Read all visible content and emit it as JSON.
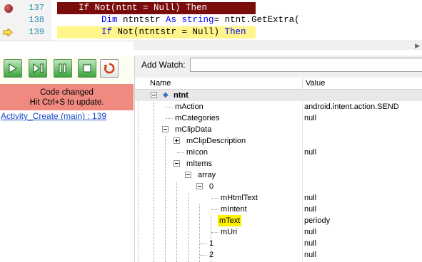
{
  "code": {
    "lines": [
      {
        "num": "137",
        "text": "If Not(ntnt = Null) Then"
      },
      {
        "num": "138",
        "kw": "Dim",
        "mid": " ntntstr ",
        "kw2": "As",
        "type": " string",
        "rest": "= ntnt.GetExtra("
      },
      {
        "num": "139",
        "text": "If Not(ntntstr = Null) Then"
      }
    ]
  },
  "toolbar": {
    "buttons": [
      "continue",
      "step-over",
      "pause",
      "stop",
      "restart"
    ]
  },
  "status": {
    "line1": "Code changed",
    "line2": "Hit Ctrl+S to update."
  },
  "stack": {
    "link": "Activity_Create (main) : 139"
  },
  "watch": {
    "add_label": "Add Watch:",
    "add_value": "",
    "col_name": "Name",
    "col_value": "Value",
    "rows": [
      {
        "name": "ntnt",
        "value": ""
      },
      {
        "name": "mAction",
        "value": "android.intent.action.SEND"
      },
      {
        "name": "mCategories",
        "value": "null"
      },
      {
        "name": "mClipData",
        "value": ""
      },
      {
        "name": "mClipDescription",
        "value": ""
      },
      {
        "name": "mIcon",
        "value": "null"
      },
      {
        "name": "mItems",
        "value": ""
      },
      {
        "name": "array",
        "value": ""
      },
      {
        "name": "0",
        "value": ""
      },
      {
        "name": "mHtmlText",
        "value": "null"
      },
      {
        "name": "mIntent",
        "value": "null"
      },
      {
        "name": "mText",
        "value": "periody"
      },
      {
        "name": "mUri",
        "value": "null"
      },
      {
        "name": "1",
        "value": "null"
      },
      {
        "name": "2",
        "value": "null"
      }
    ]
  },
  "colors": {
    "breakpoint_line": "#7b0c0c",
    "current_line": "#fff58a",
    "status_bg": "#f08a80",
    "highlight": "#fff200"
  }
}
